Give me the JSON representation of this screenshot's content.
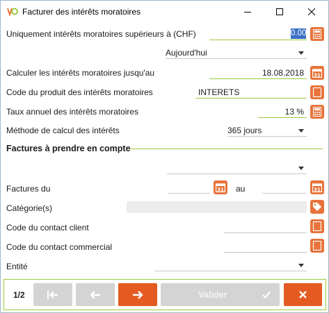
{
  "window": {
    "title": "Facturer des intérêts moratoires",
    "controls": {
      "minimize": "minimize-icon",
      "maximize": "maximize-icon",
      "close": "close-icon"
    }
  },
  "form": {
    "min_amount": {
      "label": "Uniquement intérêts moratoires supérieurs à (CHF)",
      "value": "0.00"
    },
    "date_mode": {
      "value": "Aujourd'hui"
    },
    "until_date": {
      "label": "Calculer les intérêts moratoires jusqu'au",
      "value": "18.08.2018"
    },
    "product_code": {
      "label": "Code du produit des intérêts moratoires",
      "value": "INTERETS"
    },
    "annual_rate": {
      "label": "Taux annuel des intérêts moratoires",
      "value": "13 %"
    },
    "calc_method": {
      "label": "Méthode de calcul des intérêts",
      "value": "365 jours"
    }
  },
  "invoices": {
    "section_title": "Factures à prendre en compte",
    "filter_select": {
      "value": ""
    },
    "date_from": {
      "label": "Factures du",
      "value": ""
    },
    "date_to": {
      "label": "au",
      "value": ""
    },
    "category": {
      "label": "Catégorie(s)",
      "value": ""
    },
    "client_contact": {
      "label": "Code du contact client",
      "value": ""
    },
    "sales_contact": {
      "label": "Code du contact commercial",
      "value": ""
    },
    "entity": {
      "label": "Entité",
      "value": ""
    }
  },
  "nav": {
    "page": "1/2",
    "validate_label": "Valider"
  },
  "colors": {
    "accent": "#e8743b",
    "button_active": "#e45b22",
    "button_disabled": "#d4d4d4",
    "underline": "#9bc93c",
    "selection": "#3a6fc4"
  }
}
